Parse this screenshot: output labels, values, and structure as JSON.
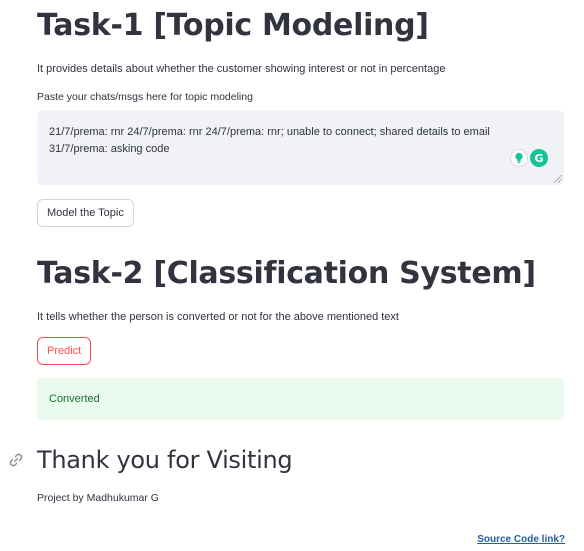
{
  "task1": {
    "title": "Task-1 [Topic Modeling]",
    "description": "It provides details about whether the customer showing interest or not in percentage",
    "textarea_label": "Paste your chats/msgs here for topic modeling",
    "textarea_value": "21/7/prema: rnr 24/7/prema: rnr 24/7/prema: rnr; unable to connect; shared details to email 31/7/prema: asking code",
    "button_label": "Model the Topic"
  },
  "task2": {
    "title": "Task-2 [Classification System]",
    "description": "It tells whether the person is converted or not for the above mentioned text",
    "button_label": "Predict",
    "result": "Converted"
  },
  "footer": {
    "heading": "Thank you for Visiting",
    "credit": "Project by Madhukumar G",
    "source_link": "Source Code link?"
  },
  "icons": {
    "textarea_tools": [
      "lightbulb-icon",
      "grammarly-icon"
    ],
    "grammarly_letter": "G",
    "heading_anchor": "link-icon"
  },
  "colors": {
    "text": "#31333f",
    "primary": "#ff4b4b",
    "success_bg": "#e9f9ee",
    "success_text": "#177233",
    "input_bg": "#f0f2f6",
    "grammarly": "#15c39a",
    "link": "#1f5ea8"
  }
}
